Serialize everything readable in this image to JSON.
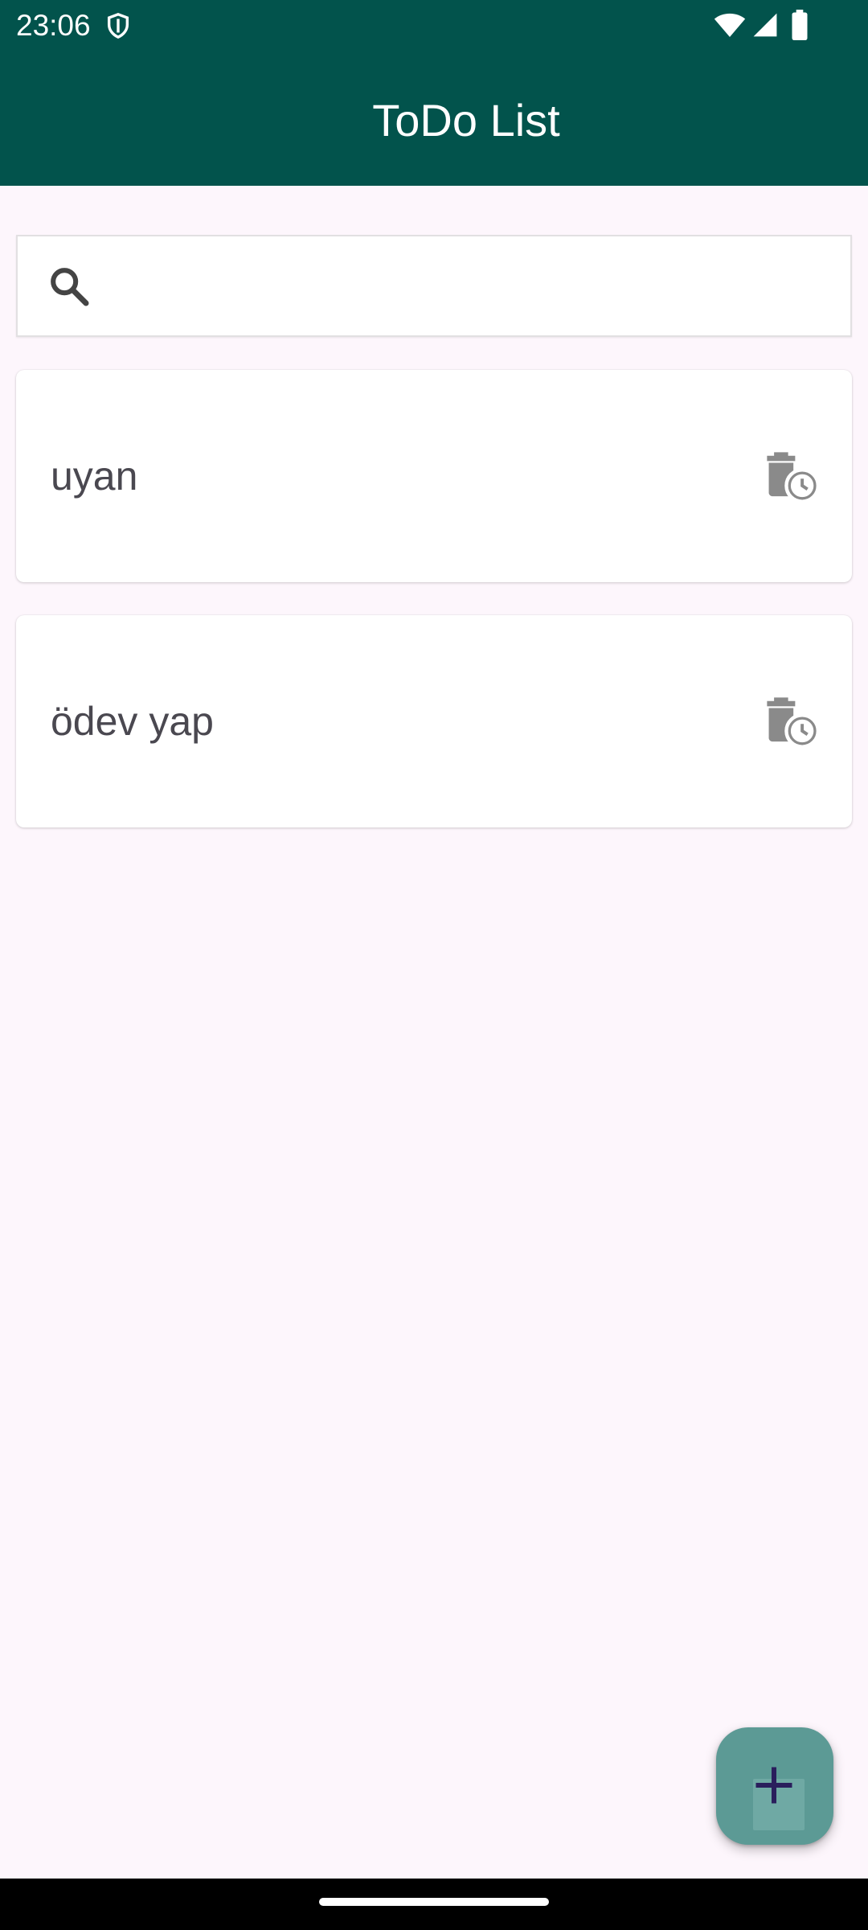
{
  "status_bar": {
    "time": "23:06",
    "icons": [
      "shield-icon",
      "wifi-icon",
      "signal-icon",
      "battery-icon"
    ]
  },
  "app_bar": {
    "title": "ToDo List",
    "background": "#02534C"
  },
  "search": {
    "icon": "search-icon",
    "value": "",
    "placeholder": ""
  },
  "todos": [
    {
      "text": "uyan",
      "action_icon": "delete-schedule-icon"
    },
    {
      "text": "ödev yap",
      "action_icon": "delete-schedule-icon"
    }
  ],
  "fab": {
    "icon": "plus-icon",
    "color": "#5C9A95"
  },
  "colors": {
    "background": "#FDF6FC",
    "card": "#FFFFFF",
    "text": "#4A4850",
    "icon": "#8A8A8A"
  }
}
